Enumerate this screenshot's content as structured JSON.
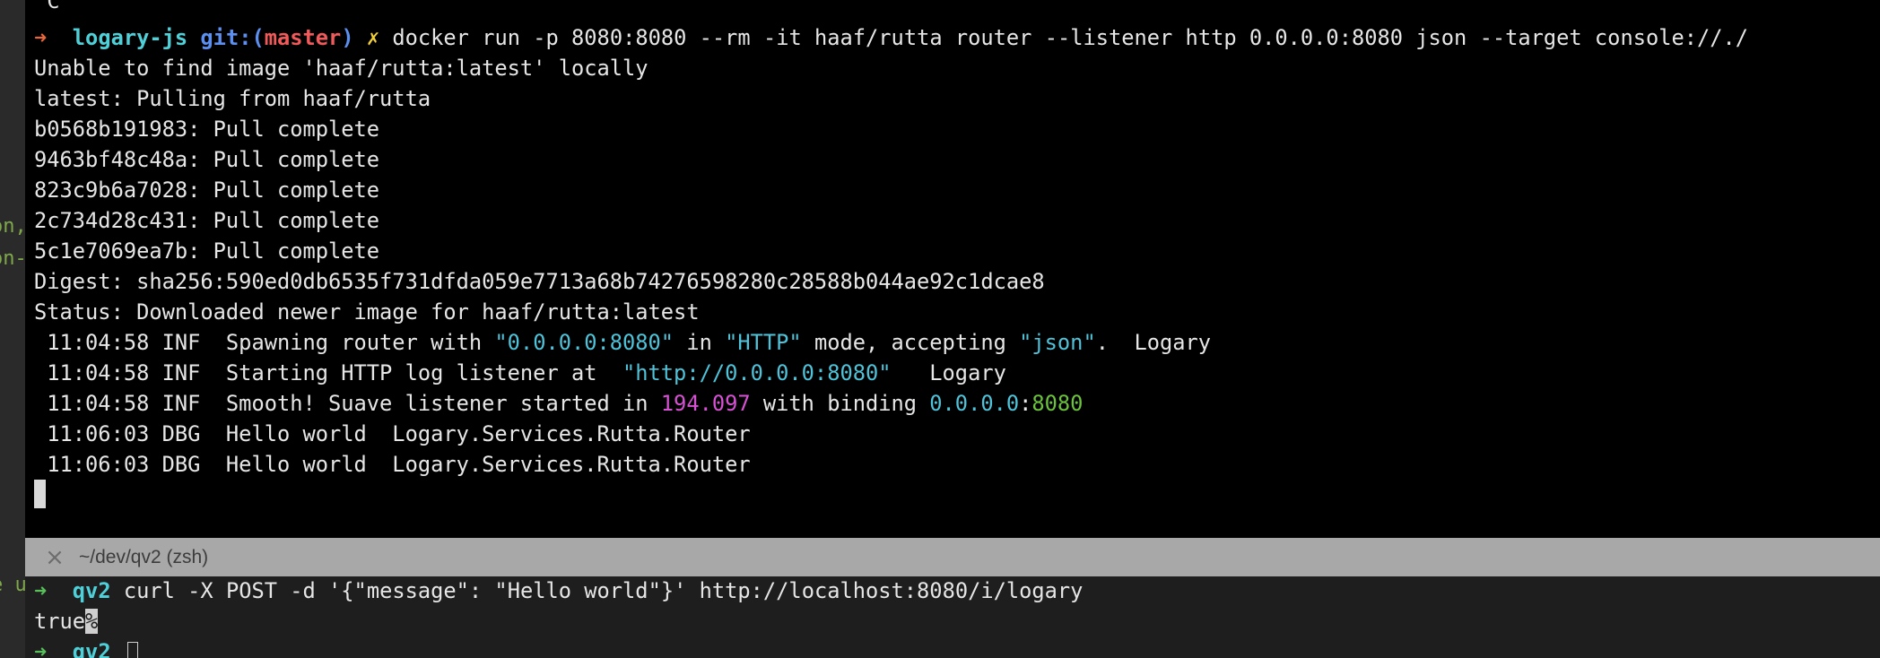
{
  "gutter": {
    "frag1": "on,",
    "frag2": "on-",
    "frag3": "e u"
  },
  "top_pane": {
    "ctrl_c": "^C",
    "prompt": {
      "arrow": "➜",
      "dir": "logary-js",
      "git_prefix": "git:(",
      "branch": "master",
      "git_suffix": ")",
      "dirty": "✗",
      "command": "docker run -p 8080:8080 --rm -it haaf/rutta router --listener http 0.0.0.0:8080 json --target console://./"
    },
    "output": [
      "Unable to find image 'haaf/rutta:latest' locally",
      "latest: Pulling from haaf/rutta",
      "b0568b191983: Pull complete",
      "9463bf48c48a: Pull complete",
      "823c9b6a7028: Pull complete",
      "2c734d28c431: Pull complete",
      "5c1e7069ea7b: Pull complete",
      "Digest: sha256:590ed0db6535f731dfda059e7713a68b74276598280c28588b044ae92c1dcae8",
      "Status: Downloaded newer image for haaf/rutta:latest"
    ],
    "log1": {
      "prefix": " 11:04:58 INF  Spawning router with ",
      "addr": "\"0.0.0.0:8080\"",
      "mid1": " in ",
      "mode": "\"HTTP\"",
      "mid2": " mode, accepting ",
      "fmt": "\"json\"",
      "suffix": ".  Logary"
    },
    "log2": {
      "prefix": " 11:04:58 INF  Starting HTTP log listener at  ",
      "url": "\"http://0.0.0.0:8080\"",
      "suffix": "   Logary"
    },
    "log3": {
      "prefix": " 11:04:58 INF  Smooth! Suave listener started in ",
      "ms": "194.097",
      "mid": " with binding ",
      "ip": "0.0.0.0",
      "colon": ":",
      "port": "8080"
    },
    "log4": " 11:06:03 DBG  Hello world  Logary.Services.Rutta.Router",
    "log5": " 11:06:03 DBG  Hello world  Logary.Services.Rutta.Router"
  },
  "divider": {
    "title": "~/dev/qv2 (zsh)"
  },
  "bottom_pane": {
    "prompt": {
      "arrow": "➜",
      "dir": "qv2",
      "command": "curl -X POST -d '{\"message\": \"Hello world\"}' http://localhost:8080/i/logary"
    },
    "result": "true",
    "no_newline_mark": "%",
    "prompt2": {
      "arrow": "➜",
      "dir": "qv2"
    }
  }
}
